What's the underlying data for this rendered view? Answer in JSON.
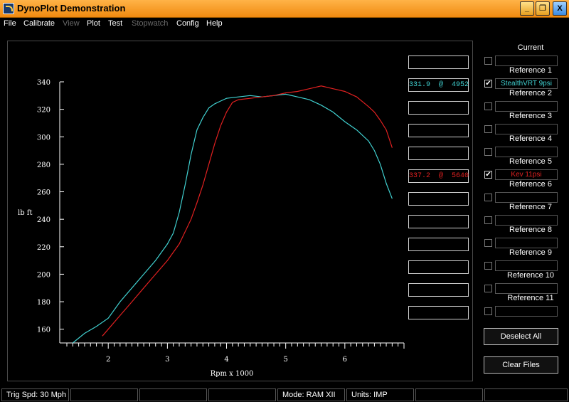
{
  "window": {
    "title": "DynoPlot Demonstration",
    "minimize_glyph": "_",
    "maximize_glyph": "❐",
    "close_glyph": "X",
    "icons": {
      "app": "dynoplot-app-icon",
      "minimize": "minimize-icon",
      "maximize": "restore-icon",
      "close": "close-icon"
    }
  },
  "menu": [
    {
      "label": "File",
      "enabled": true
    },
    {
      "label": "Calibrate",
      "enabled": true
    },
    {
      "label": "View",
      "enabled": false
    },
    {
      "label": "Plot",
      "enabled": true
    },
    {
      "label": "Test",
      "enabled": true
    },
    {
      "label": "Stopwatch",
      "enabled": false
    },
    {
      "label": "Config",
      "enabled": true
    },
    {
      "label": "Help",
      "enabled": true
    }
  ],
  "chart_data": {
    "type": "line",
    "xlabel": "Rpm x 1000",
    "ylabel": "lb ft",
    "xlim": [
      1.3,
      7.0
    ],
    "ylim": [
      150,
      340
    ],
    "x_ticks": [
      2,
      3,
      4,
      5,
      6
    ],
    "y_ticks": [
      160,
      180,
      200,
      220,
      240,
      260,
      280,
      300,
      320,
      340
    ],
    "grid": false,
    "series": [
      {
        "name": "StealthVRT 9psi",
        "color": "#40d0d0",
        "x": [
          1.4,
          1.6,
          1.8,
          2.0,
          2.2,
          2.4,
          2.6,
          2.8,
          3.0,
          3.1,
          3.2,
          3.3,
          3.4,
          3.5,
          3.6,
          3.7,
          3.8,
          3.9,
          4.0,
          4.2,
          4.4,
          4.6,
          4.8,
          5.0,
          5.2,
          5.4,
          5.6,
          5.8,
          6.0,
          6.2,
          6.4,
          6.5,
          6.6,
          6.7,
          6.8
        ],
        "y": [
          150,
          157,
          162,
          168,
          180,
          190,
          200,
          210,
          222,
          230,
          245,
          265,
          287,
          305,
          314,
          321,
          324,
          326,
          328,
          329,
          330,
          329,
          330,
          331,
          329,
          327,
          323,
          318,
          311,
          305,
          297,
          290,
          280,
          266,
          255
        ]
      },
      {
        "name": "Kev 11psi",
        "color": "#e02020",
        "x": [
          1.9,
          2.0,
          2.2,
          2.4,
          2.6,
          2.8,
          3.0,
          3.2,
          3.4,
          3.5,
          3.6,
          3.7,
          3.8,
          3.9,
          4.0,
          4.1,
          4.2,
          4.4,
          4.6,
          4.8,
          5.0,
          5.2,
          5.4,
          5.6,
          5.8,
          6.0,
          6.2,
          6.4,
          6.5,
          6.6,
          6.7,
          6.8
        ],
        "y": [
          155,
          160,
          170,
          180,
          190,
          200,
          210,
          222,
          240,
          252,
          265,
          280,
          295,
          308,
          318,
          325,
          327,
          328,
          329,
          330,
          332,
          333,
          335,
          337,
          335,
          333,
          329,
          322,
          318,
          312,
          305,
          292
        ]
      }
    ]
  },
  "readouts": [
    {
      "text": "",
      "color": "#ffffff"
    },
    {
      "text": "331.9  @  4952",
      "color": "#40d0d0"
    },
    {
      "text": "",
      "color": "#ffffff"
    },
    {
      "text": "",
      "color": "#ffffff"
    },
    {
      "text": "",
      "color": "#ffffff"
    },
    {
      "text": "337.2  @  5640",
      "color": "#e02020"
    },
    {
      "text": "",
      "color": "#ffffff"
    },
    {
      "text": "",
      "color": "#ffffff"
    },
    {
      "text": "",
      "color": "#ffffff"
    },
    {
      "text": "",
      "color": "#ffffff"
    },
    {
      "text": "",
      "color": "#ffffff"
    },
    {
      "text": "",
      "color": "#ffffff"
    }
  ],
  "references": [
    {
      "label": "Current",
      "checked": false,
      "value": "",
      "color": "#ffffff"
    },
    {
      "label": "Reference 1",
      "checked": true,
      "value": "StealthVRT 9psi",
      "color": "#40d0d0"
    },
    {
      "label": "Reference 2",
      "checked": false,
      "value": "",
      "color": "#ffffff"
    },
    {
      "label": "Reference 3",
      "checked": false,
      "value": "",
      "color": "#ffffff"
    },
    {
      "label": "Reference 4",
      "checked": false,
      "value": "",
      "color": "#ffffff"
    },
    {
      "label": "Reference 5",
      "checked": true,
      "value": "Kev 11psi",
      "color": "#e02020"
    },
    {
      "label": "Reference 6",
      "checked": false,
      "value": "",
      "color": "#ffffff"
    },
    {
      "label": "Reference 7",
      "checked": false,
      "value": "",
      "color": "#ffffff"
    },
    {
      "label": "Reference 8",
      "checked": false,
      "value": "",
      "color": "#ffffff"
    },
    {
      "label": "Reference 9",
      "checked": false,
      "value": "",
      "color": "#ffffff"
    },
    {
      "label": "Reference 10",
      "checked": false,
      "value": "",
      "color": "#ffffff"
    },
    {
      "label": "Reference 11",
      "checked": false,
      "value": "",
      "color": "#ffffff"
    }
  ],
  "check_glyph": "✔",
  "buttons": {
    "deselect_all": "Deselect All",
    "clear_files": "Clear Files"
  },
  "status": [
    "Trig Spd: 30 Mph",
    "",
    "",
    "",
    "Mode: RAM XII",
    "Units: IMP",
    "",
    ""
  ]
}
